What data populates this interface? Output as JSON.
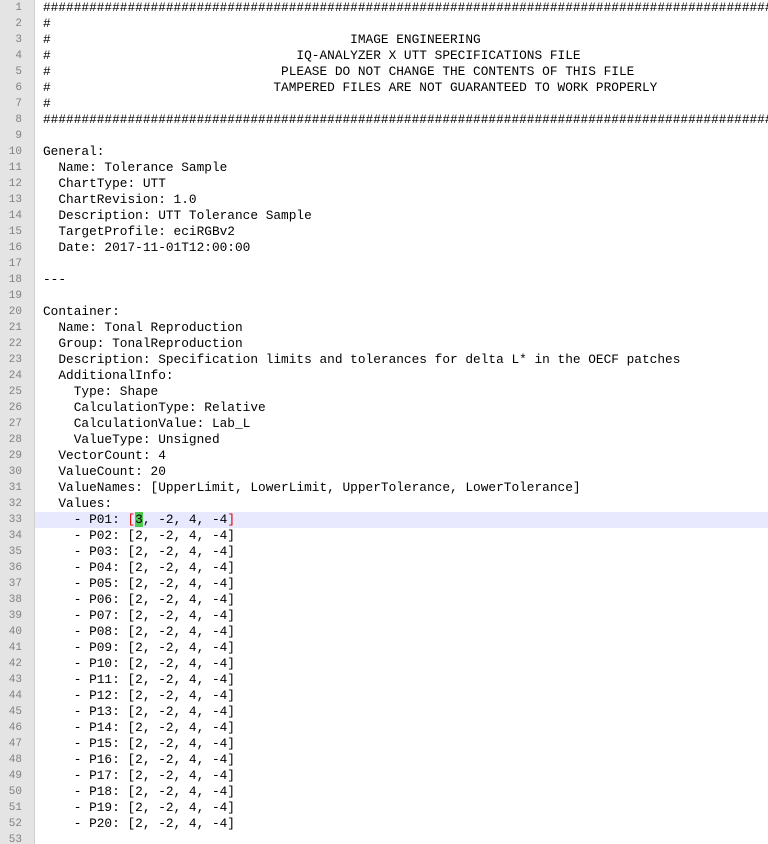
{
  "current_line": 33,
  "lines": [
    "##################################################################################################",
    "#                                                                                                #",
    "#                                       IMAGE ENGINEERING                                        #",
    "#                                IQ-ANALYZER X UTT SPECIFICATIONS FILE                          #",
    "#                              PLEASE DO NOT CHANGE THE CONTENTS OF THIS FILE                   #",
    "#                             TAMPERED FILES ARE NOT GUARANTEED TO WORK PROPERLY                #",
    "#                                                                                                #",
    "##################################################################################################",
    "",
    "General:",
    "  Name: Tolerance Sample",
    "  ChartType: UTT",
    "  ChartRevision: 1.0",
    "  Description: UTT Tolerance Sample",
    "  TargetProfile: eciRGBv2",
    "  Date: 2017-11-01T12:00:00",
    "",
    "---",
    "",
    "Container:",
    "  Name: Tonal Reproduction",
    "  Group: TonalReproduction",
    "  Description: Specification limits and tolerances for delta L* in the OECF patches",
    "  AdditionalInfo:",
    "    Type: Shape",
    "    CalculationType: Relative",
    "    CalculationValue: Lab_L",
    "    ValueType: Unsigned",
    "  VectorCount: 4",
    "  ValueCount: 20",
    "  ValueNames: [UpperLimit, LowerLimit, UpperTolerance, LowerTolerance]",
    "  Values:",
    "    - P01: [3, -2, 4, -4]",
    "    - P02: [2, -2, 4, -4]",
    "    - P03: [2, -2, 4, -4]",
    "    - P04: [2, -2, 4, -4]",
    "    - P05: [2, -2, 4, -4]",
    "    - P06: [2, -2, 4, -4]",
    "    - P07: [2, -2, 4, -4]",
    "    - P08: [2, -2, 4, -4]",
    "    - P09: [2, -2, 4, -4]",
    "    - P10: [2, -2, 4, -4]",
    "    - P11: [2, -2, 4, -4]",
    "    - P12: [2, -2, 4, -4]",
    "    - P13: [2, -2, 4, -4]",
    "    - P14: [2, -2, 4, -4]",
    "    - P15: [2, -2, 4, -4]",
    "    - P16: [2, -2, 4, -4]",
    "    - P17: [2, -2, 4, -4]",
    "    - P18: [2, -2, 4, -4]",
    "    - P19: [2, -2, 4, -4]",
    "    - P20: [2, -2, 4, -4]",
    ""
  ]
}
